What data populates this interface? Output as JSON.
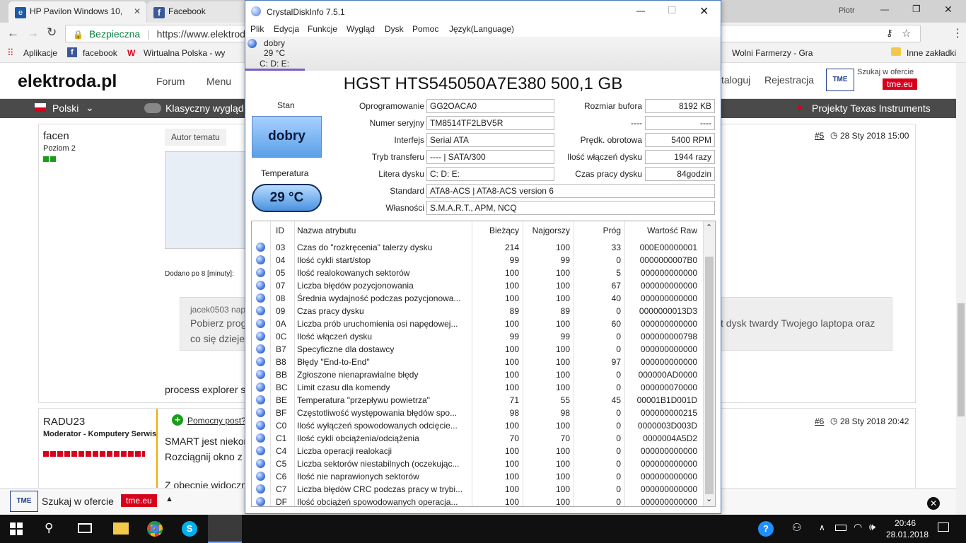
{
  "browser": {
    "tabs": [
      {
        "label": "HP Pavilon Windows 10,",
        "close": "✕"
      },
      {
        "label": "Facebook",
        "close": "✕"
      }
    ],
    "user": "Piotr",
    "window_controls": {
      "minimize": "—",
      "restore": "❐",
      "close": "✕"
    },
    "nav": {
      "back": "←",
      "forward": "→",
      "reload": "↻"
    },
    "secure_label": "Bezpieczna",
    "url": "https://www.elektroda.",
    "bookmarks": {
      "apps": "Aplikacje",
      "facebook": "facebook",
      "wp": "Wirtualna Polska - wy",
      "farmer": "Wolni Farmerzy - Gra",
      "other": "Inne zakładki"
    }
  },
  "site": {
    "logo": "elektroda.pl",
    "nav": {
      "forum": "Forum",
      "menu": "Menu",
      "catalog": "taloguj",
      "register": "Rejestracja"
    },
    "tme_search": "Szukaj w ofercie",
    "tme_badge": "tme.eu",
    "lang": "Polski",
    "classic_view": "Klasyczny wygląd",
    "ti_projects": "Projekty Texas Instruments",
    "posts": [
      {
        "user": "facen",
        "rank": "Poziom 2",
        "author_btn": "Autor tematu",
        "post_no": "#5",
        "date": "28 Sty 2018 15:00",
        "added_after": "Dodano po 8 [minuty]:",
        "quote_author": "jacek0503 nap",
        "quote_text_1": "Pobierz prog",
        "quote_text_2": "co się dzieje z",
        "quote_right": "t dysk twardy Twojego laptopa oraz",
        "body_tail": "process explorer so"
      },
      {
        "user": "RADU23",
        "rank": "Moderator - Komputery Serwis",
        "helpful": "Pomocny post?",
        "post_no": "#6",
        "date": "28 Sty 2018 20:42",
        "line1": "SMART jest niekon",
        "line2": "Rozciągnij okno z C",
        "line3": "Z obecnie widoczn"
      }
    ],
    "bottom_bar": {
      "search": "Szukaj w ofercie",
      "badge": "tme.eu"
    }
  },
  "cdi": {
    "title": "CrystalDiskInfo 7.5.1",
    "window_controls": {
      "minimize": "—",
      "maximize": "☐",
      "close": "✕"
    },
    "menu": [
      "Plik",
      "Edycja",
      "Funkcje",
      "Wygląd",
      "Dysk",
      "Pomoc",
      "Język(Language)"
    ],
    "drive_tab": {
      "status": "dobry",
      "temp": "29 °C",
      "letters": "C: D: E:"
    },
    "model": "HGST HTS545050A7E380 500,1 GB",
    "status_label": "Stan",
    "status_value": "dobry",
    "temp_label": "Temperatura",
    "temp_value": "29 °C",
    "left_fields": [
      {
        "label": "Oprogramowanie",
        "value": "GG2OACA0"
      },
      {
        "label": "Numer seryjny",
        "value": "TM8514TF2LBV5R"
      },
      {
        "label": "Interfejs",
        "value": "Serial ATA"
      },
      {
        "label": "Tryb transferu",
        "value": "---- | SATA/300"
      },
      {
        "label": "Litera dysku",
        "value": "C: D: E:"
      }
    ],
    "right_fields": [
      {
        "label": "Rozmiar bufora",
        "value": "8192 KB"
      },
      {
        "label": "----",
        "value": "----"
      },
      {
        "label": "Prędk. obrotowa",
        "value": "5400 RPM"
      },
      {
        "label": "Ilość włączeń dysku",
        "value": "1944 razy"
      },
      {
        "label": "Czas pracy dysku",
        "value": "84godzin"
      }
    ],
    "standard_label": "Standard",
    "standard_value": "ATA8-ACS | ATA8-ACS version 6",
    "features_label": "Własności",
    "features_value": "S.M.A.R.T., APM, NCQ",
    "table_headers": [
      "ID",
      "Nazwa atrybutu",
      "Bieżący",
      "Najgorszy",
      "Próg",
      "Wartość Raw"
    ],
    "rows": [
      [
        "03",
        "Czas do \"rozkręcenia\" talerzy dysku",
        "214",
        "100",
        "33",
        "000E00000001"
      ],
      [
        "04",
        "Ilość cykli start/stop",
        "99",
        "99",
        "0",
        "0000000007B0"
      ],
      [
        "05",
        "Ilość realokowanych sektorów",
        "100",
        "100",
        "5",
        "000000000000"
      ],
      [
        "07",
        "Liczba błędów pozycjonowania",
        "100",
        "100",
        "67",
        "000000000000"
      ],
      [
        "08",
        "Średnia wydajność podczas pozycjonowa...",
        "100",
        "100",
        "40",
        "000000000000"
      ],
      [
        "09",
        "Czas pracy dysku",
        "89",
        "89",
        "0",
        "0000000013D3"
      ],
      [
        "0A",
        "Liczba prób uruchomienia osi napędowej...",
        "100",
        "100",
        "60",
        "000000000000"
      ],
      [
        "0C",
        "Ilość włączeń dysku",
        "99",
        "99",
        "0",
        "000000000798"
      ],
      [
        "B7",
        "Specyficzne dla dostawcy",
        "100",
        "100",
        "0",
        "000000000000"
      ],
      [
        "B8",
        "Błędy \"End-to-End\"",
        "100",
        "100",
        "97",
        "000000000000"
      ],
      [
        "BB",
        "Zgłoszone nienaprawialne błędy",
        "100",
        "100",
        "0",
        "000000AD0000"
      ],
      [
        "BC",
        "Limit czasu dla komendy",
        "100",
        "100",
        "0",
        "000000070000"
      ],
      [
        "BE",
        "Temperatura \"przepływu powietrza\"",
        "71",
        "55",
        "45",
        "00001B1D001D"
      ],
      [
        "BF",
        "Częstotliwość występowania błędów spo...",
        "98",
        "98",
        "0",
        "000000000215"
      ],
      [
        "C0",
        "Ilość wyłączeń spowodowanych odcięcie...",
        "100",
        "100",
        "0",
        "0000003D003D"
      ],
      [
        "C1",
        "Ilość cykli obciążenia/odciążenia",
        "70",
        "70",
        "0",
        "0000004A5D2"
      ],
      [
        "C4",
        "Liczba operacji realokacji",
        "100",
        "100",
        "0",
        "000000000000"
      ],
      [
        "C5",
        "Liczba sektorów niestabilnych (oczekując...",
        "100",
        "100",
        "0",
        "000000000000"
      ],
      [
        "C6",
        "Ilość nie naprawionych sektorów",
        "100",
        "100",
        "0",
        "000000000000"
      ],
      [
        "C7",
        "Liczba błędów CRC podczas pracy w trybi...",
        "100",
        "100",
        "0",
        "000000000000"
      ],
      [
        "DF",
        "Ilość obciążeń spowodowanych operacja...",
        "100",
        "100",
        "0",
        "000000000000"
      ]
    ]
  },
  "taskbar": {
    "time": "20:46",
    "date": "28.01.2018"
  },
  "colors": {
    "accent_blue": "#3a7bd5",
    "tme_red": "#d9001b",
    "good_blue": "#5aa0e8"
  }
}
